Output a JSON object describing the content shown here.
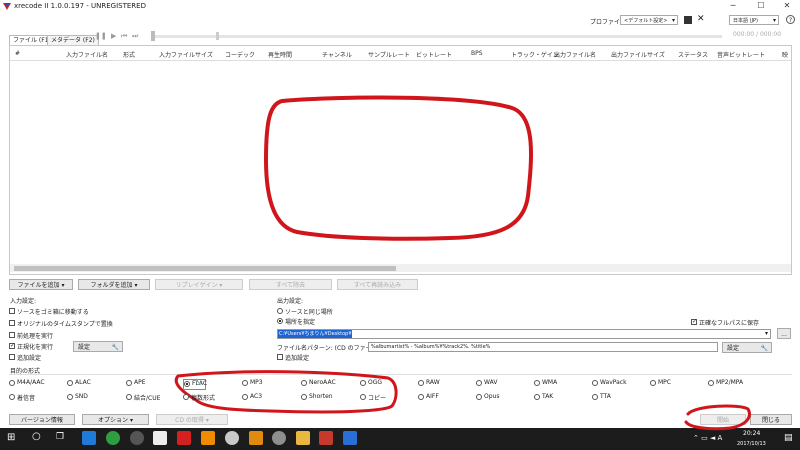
{
  "window": {
    "title": "xrecode II 1.0.0.197 - UNREGISTERED",
    "minimize": "─",
    "maximize": "☐",
    "close": "✕"
  },
  "profile": {
    "label": "プロファイル:",
    "value": "<デフォルト設定>",
    "language": "日本語 (JP)"
  },
  "tabs": [
    "ファイル (F1)",
    "メタデータ (F2)"
  ],
  "player": {
    "time": "000:00 / 000:00"
  },
  "table": {
    "columns": [
      "#",
      "入力ファイル名",
      "形式",
      "入力ファイルサイズ",
      "コーデック",
      "再生時間",
      "チャンネル",
      "サンプルレート",
      "ビットレート",
      "BPS",
      "トラック・ゲイン",
      "出力ファイル名",
      "出力ファイルサイズ",
      "ステータス",
      "音声ビットレート",
      "映"
    ]
  },
  "actions": {
    "add_file": "ファイルを追加",
    "add_folder": "フォルダを追加",
    "replaygain": "リプレイゲイン",
    "remove_all": "すべて除去",
    "reload_all": "すべて再読み込み"
  },
  "input_settings": {
    "title": "入力設定:",
    "move_to_trash": "ソースをゴミ箱に移動する",
    "keep_original_timestamp": "オリジナルのタイムスタンプで置換",
    "run_preprocess": "前処理を実行",
    "run_normalize": "正規化を実行",
    "normalize_settings": "設定",
    "add_settings": "追加設定"
  },
  "output_settings": {
    "title": "出力設定:",
    "same_as_source": "ソースと同じ場所",
    "specify_location": "場所を指定",
    "full_path": "正確なフルパスに保存",
    "path": "C:¥Users¥ちまりん¥Desktop¥",
    "browse": "...",
    "pattern_label": "ファイル名パターン: (CD のファイル名)",
    "pattern": "%albumartist% - %album%¥%track2%. %title%",
    "pattern_settings": "設定",
    "add_settings": "追加設定"
  },
  "format": {
    "title": "目的の形式",
    "row1": [
      "M4A/AAC",
      "ALAC",
      "APE",
      "FLAC",
      "MP3",
      "NeroAAC",
      "OGG",
      "RAW",
      "WAV",
      "WMA",
      "WavPack",
      "MPC",
      "MP2/MPA"
    ],
    "row2": [
      "着信音",
      "SND",
      "結合/CUE",
      "複数形式",
      "AC3",
      "Shorten",
      "コピー",
      "AIFF",
      "Opus",
      "TAK",
      "TTA"
    ],
    "selected": "FLAC"
  },
  "footer": {
    "version_info": "バージョン情報",
    "options": "オプション",
    "cd_get": "CD の取得",
    "start": "開始",
    "close": "閉じる"
  },
  "taskbar": {
    "time": "20:24",
    "date": "2017/10/13",
    "icons": [
      "start-icon",
      "search-icon",
      "task-view-icon",
      "edge-icon",
      "chrome-icon",
      "settings-icon",
      "clapper-icon",
      "xrecode-icon",
      "vlc-icon",
      "headphones-icon",
      "sublime-icon",
      "ring-icon",
      "folder-icon",
      "mail-icon",
      "app-icon"
    ]
  },
  "colors": {
    "annotation_red": "#d0161a",
    "selection_blue": "#1c64d4",
    "taskbar": "#1c1c1c"
  }
}
